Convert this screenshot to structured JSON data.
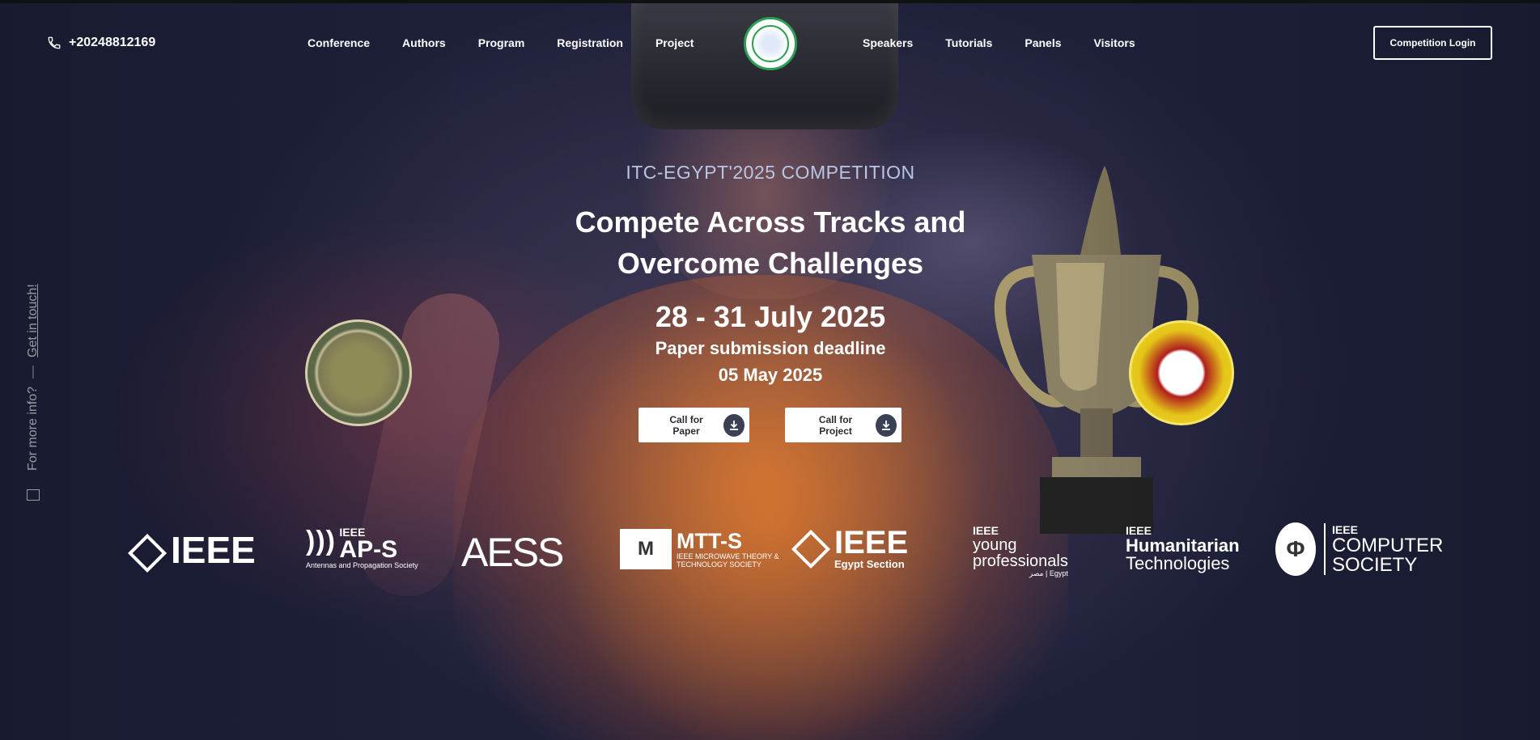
{
  "header": {
    "phone": "+20248812169",
    "nav_left": [
      "Conference",
      "Authors",
      "Program",
      "Registration",
      "Project"
    ],
    "nav_right": [
      "Speakers",
      "Tutorials",
      "Panels",
      "Visitors"
    ],
    "login_label": "Competition Login"
  },
  "side": {
    "more_info": "For more info?",
    "dash": "—",
    "get_in_touch": "Get in touch!"
  },
  "hero": {
    "kicker": "ITC-EGYPT'2025 COMPETITION",
    "headline_line1": "Compete Across Tracks and",
    "headline_line2": "Overcome Challenges",
    "dates": "28 - 31 July 2025",
    "deadline_label": "Paper submission deadline",
    "deadline_date": "05 May 2025",
    "cta_paper": "Call for Paper",
    "cta_project": "Call for Project"
  },
  "sponsors": {
    "ieee": "IEEE",
    "aps_top": "IEEE",
    "aps_main": "AP-S",
    "aps_sub": "Antennas and Propagation Society",
    "aess": "AESS",
    "mtts_main": "MTT-S",
    "mtts_sub1": "IEEE MICROWAVE THEORY &",
    "mtts_sub2": "TECHNOLOGY SOCIETY",
    "egypt_main": "IEEE",
    "egypt_sub": "Egypt Section",
    "yp_top": "IEEE",
    "yp_mid1": "young",
    "yp_mid2": "professionals",
    "yp_sub": "مصر | Egypt",
    "ht_top": "IEEE",
    "ht_l1": "Humanitarian",
    "ht_l2": "Technologies",
    "cs_top": "IEEE",
    "cs_l1": "COMPUTER",
    "cs_l2": "SOCIETY"
  },
  "colors": {
    "kicker": "#b9c6e3",
    "button_icon_bg": "#3b4054",
    "logo_ring": "#2e9e55"
  }
}
